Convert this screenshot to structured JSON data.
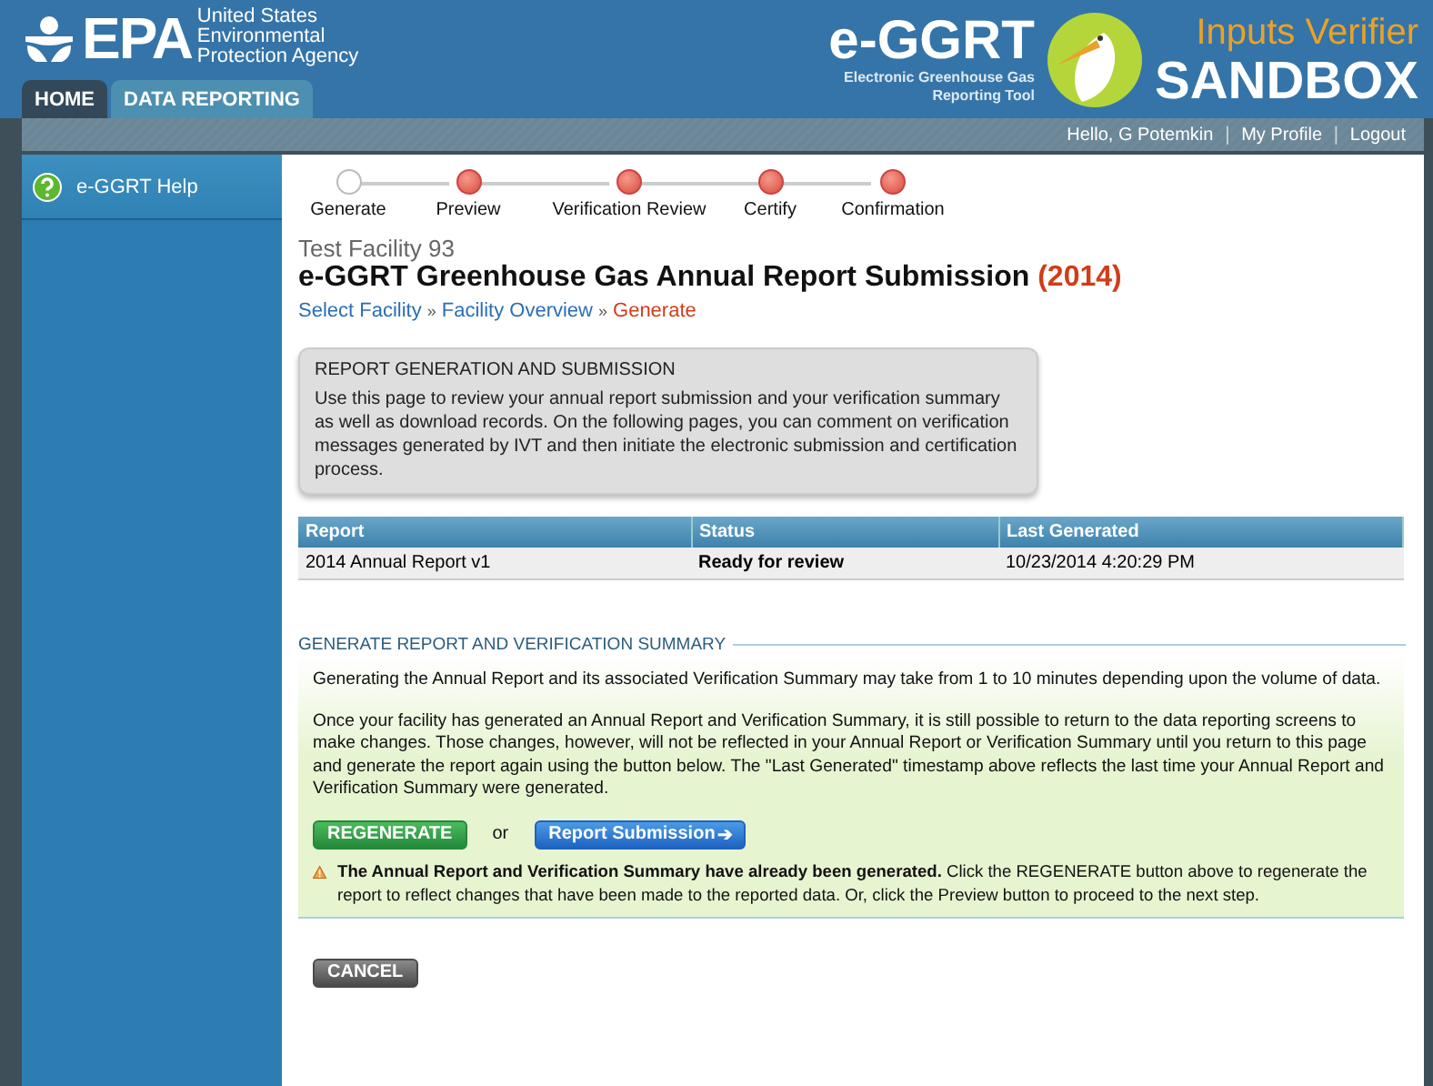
{
  "header": {
    "agency_mark": "EPA",
    "agency_name": "United States Environmental Protection Agency",
    "app_logo": "e-GGRT",
    "app_subtitle": "Electronic Greenhouse Gas Reporting Tool",
    "edition_line_1": "Inputs Verifier",
    "edition_line_2": "SANDBOX"
  },
  "tabs": [
    {
      "label": "HOME",
      "selected": false
    },
    {
      "label": "DATA REPORTING",
      "selected": true
    }
  ],
  "user_links": [
    "Hello, G Potemkin",
    "My Profile",
    "Logout"
  ],
  "link_separator": "|",
  "breadcrumb_separator": "»",
  "sidebar": {
    "items": [
      {
        "label": "e-GGRT Help"
      }
    ]
  },
  "steps": [
    {
      "label": "Generate",
      "selected": true
    },
    {
      "label": "Preview",
      "selected": false
    },
    {
      "label": "Verification Review",
      "selected": false
    },
    {
      "label": "Certify",
      "selected": false
    },
    {
      "label": "Confirmation",
      "selected": false
    }
  ],
  "facility": "Test Facility 93",
  "page_title": "e-GGRT Greenhouse Gas Annual Report Submission",
  "page_year": "(2014)",
  "breadcrumbs": [
    {
      "label": "Select Facility",
      "current": false
    },
    {
      "label": "Facility Overview",
      "current": false
    },
    {
      "label": "Generate",
      "current": true
    }
  ],
  "info_box": {
    "title": "REPORT GENERATION AND SUBMISSION",
    "text": "Use this page to review your annual report submission and your verification summary as well as download records. On the following pages, you can comment on verification messages generated by IVT and then initiate the electronic submission and certification process."
  },
  "table": {
    "columns": [
      "Report",
      "Status",
      "Last Generated"
    ],
    "rows": [
      [
        "2014 Annual Report v1",
        "Ready for review",
        "10/23/2014 4:20:29 PM"
      ]
    ]
  },
  "generate_section": {
    "title": "GENERATE REPORT AND VERIFICATION SUMMARY",
    "paragraphs": [
      "Generating the Annual Report and its associated Verification Summary may take from 1 to 10 minutes depending upon the volume of data.",
      "Once your facility has generated an Annual Report and Verification Summary, it is still possible to return to the data reporting screens to make changes. Those changes, however, will not be reflected in your Annual Report or Verification Summary until you return to this page and generate the report again using the button below. The \"Last Generated\" timestamp above reflects the last time your Annual Report and Verification Summary were generated."
    ],
    "regenerate_button": "REGENERATE",
    "or": "or",
    "submit_button": "Report Submission",
    "submit_arrow": "➔",
    "warning": "**The Annual Report and Verification Summary have already been generated.** Click the REGENERATE button above to regenerate the report to reflect changes that have been made to the reported data. Or, click the Preview button to proceed to the next step."
  },
  "cancel_button": "CANCEL"
}
